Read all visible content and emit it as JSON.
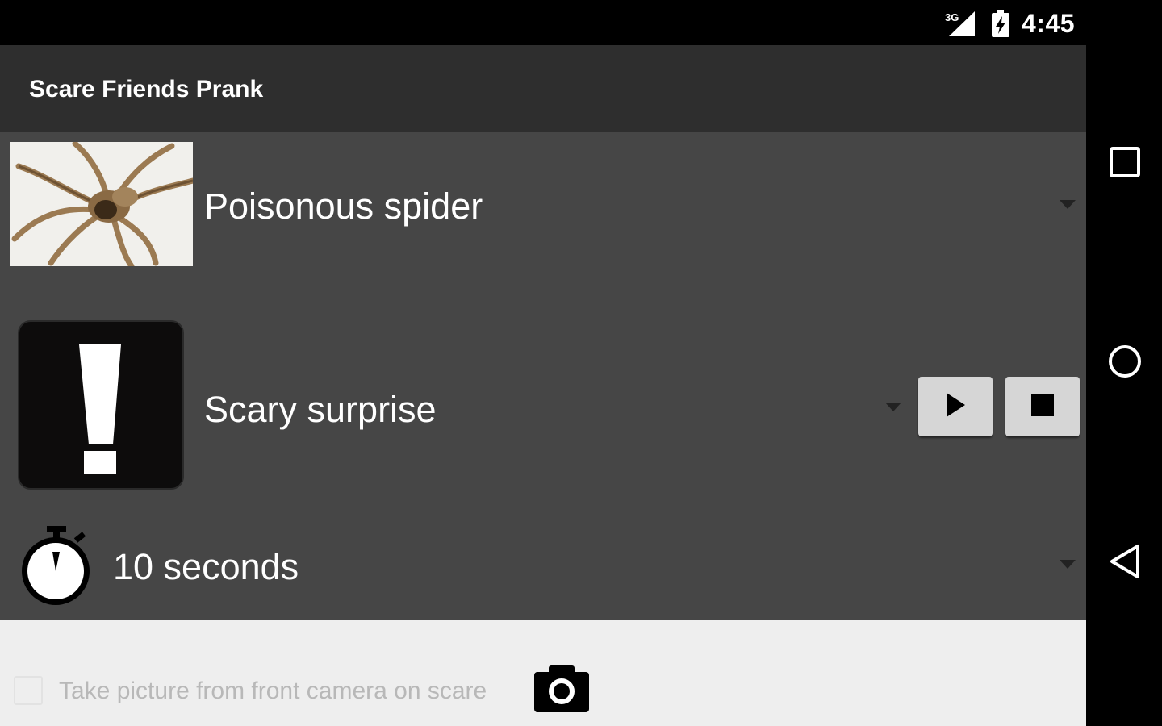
{
  "status_bar": {
    "network": "3G",
    "time": "4:45",
    "icons": [
      "signal-icon",
      "battery-charging-icon"
    ]
  },
  "app_bar": {
    "title": "Scare Friends Prank"
  },
  "scare_image": {
    "selected": "Poisonous spider",
    "thumbnail": "spider-photo"
  },
  "scare_sound": {
    "selected": "Scary surprise",
    "icon": "exclamation-icon",
    "play_icon": "play-icon",
    "stop_icon": "stop-icon"
  },
  "delay": {
    "selected": "10 seconds",
    "icon": "stopwatch-icon"
  },
  "front_camera": {
    "label": "Take picture from front camera on scare",
    "checked": false,
    "icon": "camera-icon"
  },
  "nav_bar": {
    "buttons": [
      "recents-icon",
      "home-icon",
      "back-icon"
    ]
  },
  "colors": {
    "app_bar": "#2e2e2e",
    "content_background": "#464646",
    "bottom_panel": "#eeeeee"
  }
}
